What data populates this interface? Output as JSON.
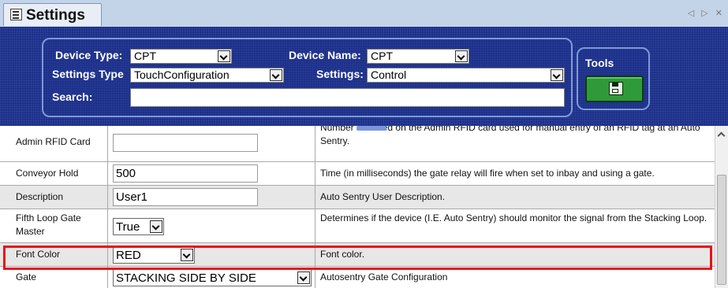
{
  "titlebar": {
    "title": "Settings",
    "nav_arrows": "◁ ▷ ✕"
  },
  "filters": {
    "device_type": {
      "label": "Device Type:",
      "value": "CPT"
    },
    "device_name": {
      "label": "Device Name:",
      "value": "CPT"
    },
    "settings_type": {
      "label": "Settings Type",
      "value": "TouchConfiguration"
    },
    "settings": {
      "label": "Settings:",
      "value": "Control"
    },
    "search": {
      "label": "Search:",
      "value": ""
    }
  },
  "tools": {
    "label": "Tools",
    "save_icon": "floppy-disk-icon"
  },
  "grid": {
    "rows": [
      {
        "name": "Admin RFID Card",
        "value": "",
        "description": "Number encoded on the Admin RFID card used for manual entry of an RFID tag at an Auto Sentry."
      },
      {
        "name": "Conveyor Hold",
        "value": "500",
        "description": "Time (in milliseconds) the gate relay will fire when set to inbay and using a gate."
      },
      {
        "name": "Description",
        "value": "User1",
        "description": "Auto Sentry User Description."
      },
      {
        "name": "Fifth Loop Gate Master",
        "value": "True",
        "description": "Determines if the device (I.E. Auto Sentry) should monitor the signal from the Stacking Loop."
      },
      {
        "name": "Font Color",
        "value": "RED",
        "description": "Font color."
      },
      {
        "name": "Gate",
        "value": "STACKING SIDE BY SIDE",
        "description": "Autosentry Gate Configuration"
      }
    ]
  },
  "colors": {
    "header_blue": "#1b2f8a",
    "highlight_red": "#e8111a",
    "tools_green": "#2f9a3a"
  }
}
